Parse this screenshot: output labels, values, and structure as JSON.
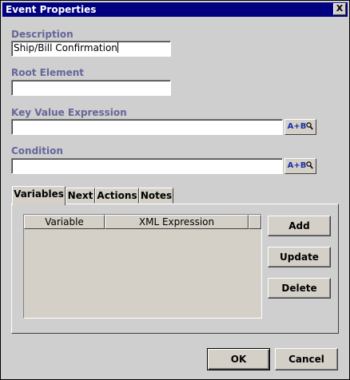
{
  "window": {
    "title": "Event Properties",
    "close_label": "X"
  },
  "description": {
    "label": "Description",
    "value": "Ship/Bill Confirmation"
  },
  "root_element": {
    "label": "Root Element",
    "value": ""
  },
  "key_value_expression": {
    "label": "Key Value Expression",
    "value": "",
    "button_label": "A+B"
  },
  "condition": {
    "label": "Condition",
    "value": "",
    "button_label": "A+B"
  },
  "tabs": [
    {
      "label": "Variables",
      "active": true
    },
    {
      "label": "Next",
      "active": false
    },
    {
      "label": "Actions",
      "active": false
    },
    {
      "label": "Notes",
      "active": false
    }
  ],
  "variables_table": {
    "columns": [
      "Variable",
      "XML Expression"
    ],
    "rows": []
  },
  "side_buttons": {
    "add": "Add",
    "update": "Update",
    "delete": "Delete"
  },
  "footer": {
    "ok": "OK",
    "cancel": "Cancel"
  }
}
